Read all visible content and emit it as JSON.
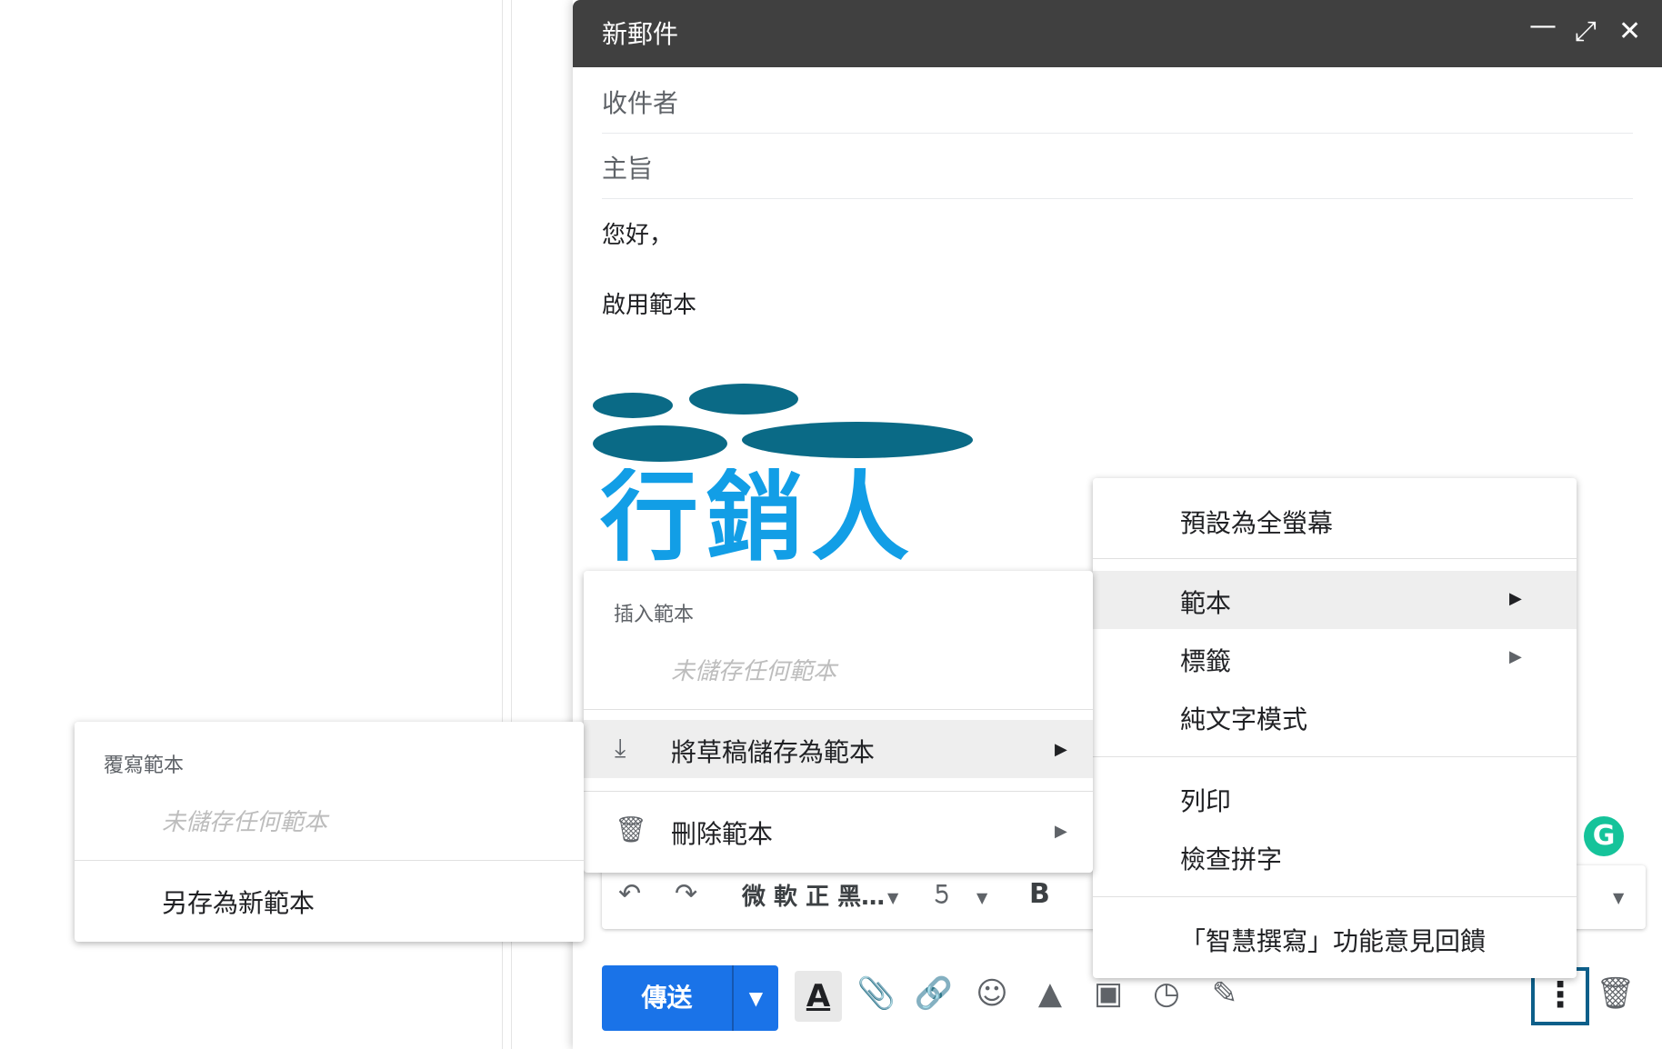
{
  "compose": {
    "title": "新郵件",
    "minimize_icon": "minimize-icon",
    "expand_icon": "expand-icon",
    "close_icon": "close-icon",
    "to_placeholder": "收件者",
    "subject_placeholder": "主旨",
    "body_greeting": "您好，",
    "body_line": "啟用範本",
    "signature_logo_text": "行銷人"
  },
  "format_toolbar": {
    "undo_icon": "undo-icon",
    "redo_icon": "redo-icon",
    "font_name": "微 軟 正 黑…",
    "font_size_icon": "font-size-icon",
    "bold_label": "B",
    "more_formatting_icon": "chevron-down-icon"
  },
  "actions": {
    "send_label": "傳送",
    "send_options_icon": "chevron-down-icon",
    "text_format_label": "A",
    "attach_icon": "paperclip-icon",
    "link_icon": "link-icon",
    "emoji_icon": "emoji-icon",
    "drive_icon": "drive-icon",
    "photo_icon": "photo-icon",
    "confidential_icon": "lock-clock-icon",
    "signature_icon": "pen-icon",
    "more_options_icon": "more-vert-icon",
    "discard_icon": "trash-icon"
  },
  "more_menu": {
    "items": [
      "預設為全螢幕",
      "範本",
      "標籤",
      "純文字模式",
      "列印",
      "檢查拼字",
      "「智慧撰寫」功能意見回饋"
    ]
  },
  "templates_menu": {
    "insert_header": "插入範本",
    "insert_placeholder": "未儲存任何範本",
    "save_draft_label": "將草稿儲存為範本",
    "delete_label": "刪除範本"
  },
  "save_submenu": {
    "overwrite_header": "覆寫範本",
    "overwrite_placeholder": "未儲存任何範本",
    "save_new_label": "另存為新範本"
  }
}
